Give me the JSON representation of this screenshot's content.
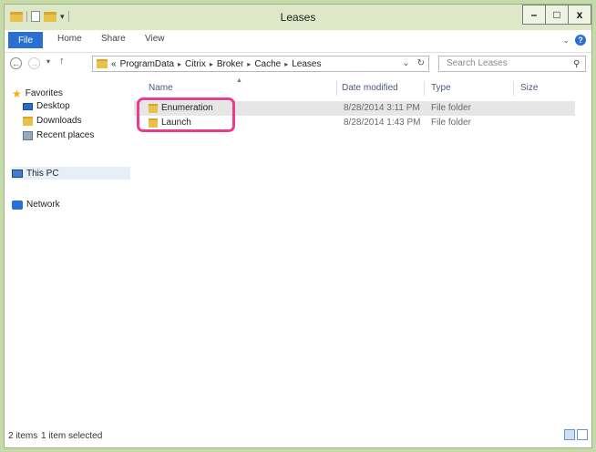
{
  "window": {
    "title": "Leases"
  },
  "window_controls": {
    "minimize": "–",
    "maximize": "□",
    "close": "x"
  },
  "ribbon": {
    "tabs": [
      "File",
      "Home",
      "Share",
      "View"
    ]
  },
  "address": {
    "overflow": "«",
    "breadcrumbs": [
      "ProgramData",
      "Citrix",
      "Broker",
      "Cache",
      "Leases"
    ]
  },
  "search": {
    "placeholder": "Search Leases"
  },
  "nav_pane": {
    "favorites": "Favorites",
    "favorites_items": [
      "Desktop",
      "Downloads",
      "Recent places"
    ],
    "this_pc": "This PC",
    "network": "Network"
  },
  "columns": {
    "name": "Name",
    "date": "Date modified",
    "type": "Type",
    "size": "Size"
  },
  "rows": [
    {
      "name": "Enumeration",
      "date": "8/28/2014 3:11 PM",
      "type": "File folder",
      "selected": true
    },
    {
      "name": "Launch",
      "date": "8/28/2014 1:43 PM",
      "type": "File folder",
      "selected": false
    }
  ],
  "status": {
    "count": "2 items",
    "selected": "1 item selected"
  },
  "colors": {
    "titlebar_bg": "#dde8c9",
    "file_tab_bg": "#2a6fd4",
    "highlight_border": "#ee3a8c"
  }
}
